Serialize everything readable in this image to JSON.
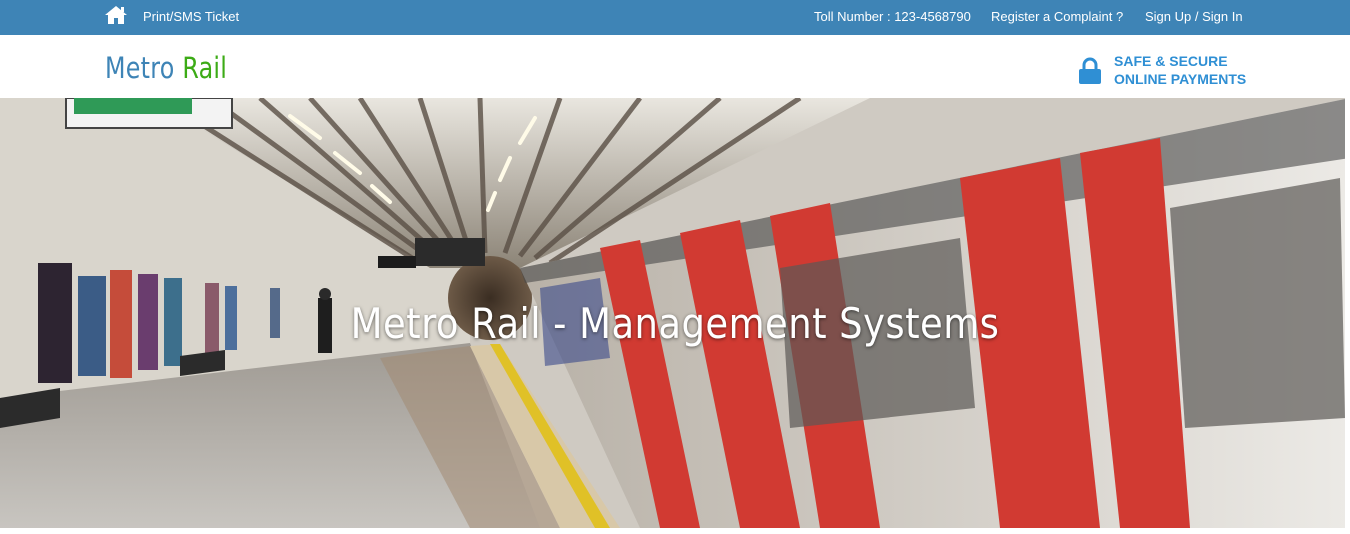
{
  "topbar": {
    "print_ticket": "Print/SMS Ticket",
    "toll_number": "Toll Number : 123-4568790",
    "register_complaint": "Register a Complaint ?",
    "sign_in": "Sign Up / Sign In"
  },
  "header": {
    "logo_part1": "Metro",
    "logo_part2": "Rail",
    "secure_line1": "SAFE & SECURE",
    "secure_line2": "ONLINE PAYMENTS"
  },
  "hero": {
    "title": "Metro Rail - Management Systems"
  },
  "colors": {
    "topbar": "#3e84b6",
    "logo_blue": "#3e84b6",
    "logo_green": "#3cab16",
    "secure_blue": "#2f8fd4"
  },
  "icons": {
    "home": "home-icon",
    "lock": "lock-icon"
  }
}
